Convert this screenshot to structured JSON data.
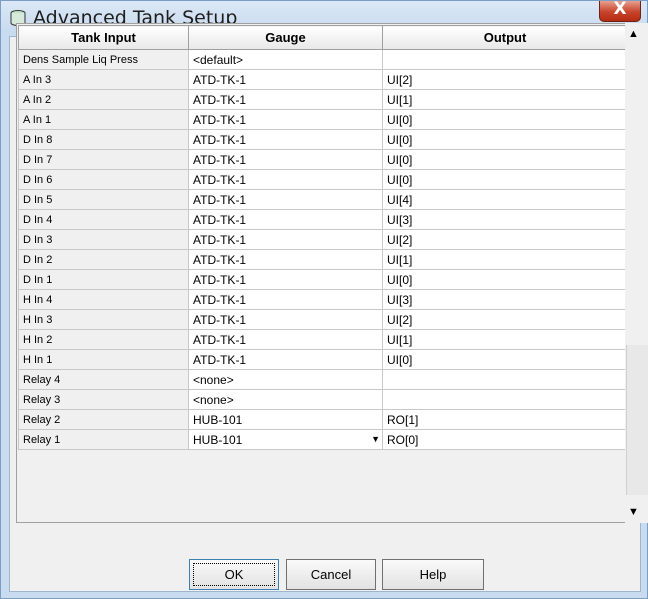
{
  "window": {
    "title": "Advanced Tank Setup",
    "close_label": "X"
  },
  "grid": {
    "headers": [
      "Tank Input",
      "Gauge",
      "Output"
    ],
    "rows": [
      {
        "input": "Dens Sample Liq Press",
        "gauge": "<default>",
        "output": ""
      },
      {
        "input": "A In 3",
        "gauge": "ATD-TK-1",
        "output": "UI[2]"
      },
      {
        "input": "A In 2",
        "gauge": "ATD-TK-1",
        "output": "UI[1]"
      },
      {
        "input": "A In 1",
        "gauge": "ATD-TK-1",
        "output": "UI[0]"
      },
      {
        "input": "D In 8",
        "gauge": "ATD-TK-1",
        "output": "UI[0]"
      },
      {
        "input": "D In 7",
        "gauge": "ATD-TK-1",
        "output": "UI[0]"
      },
      {
        "input": "D In 6",
        "gauge": "ATD-TK-1",
        "output": "UI[0]"
      },
      {
        "input": "D In 5",
        "gauge": "ATD-TK-1",
        "output": "UI[4]"
      },
      {
        "input": "D In 4",
        "gauge": "ATD-TK-1",
        "output": "UI[3]"
      },
      {
        "input": "D In 3",
        "gauge": "ATD-TK-1",
        "output": "UI[2]"
      },
      {
        "input": "D In 2",
        "gauge": "ATD-TK-1",
        "output": "UI[1]"
      },
      {
        "input": "D In 1",
        "gauge": "ATD-TK-1",
        "output": "UI[0]"
      },
      {
        "input": "H In 4",
        "gauge": "ATD-TK-1",
        "output": "UI[3]"
      },
      {
        "input": "H In 3",
        "gauge": "ATD-TK-1",
        "output": "UI[2]"
      },
      {
        "input": "H In 2",
        "gauge": "ATD-TK-1",
        "output": "UI[1]"
      },
      {
        "input": "H In 1",
        "gauge": "ATD-TK-1",
        "output": "UI[0]"
      },
      {
        "input": "Relay 4",
        "gauge": "<none>",
        "output": ""
      },
      {
        "input": "Relay 3",
        "gauge": "<none>",
        "output": ""
      },
      {
        "input": "Relay 2",
        "gauge": "HUB-101",
        "output": "RO[1]"
      },
      {
        "input": "Relay 1",
        "gauge": "HUB-101",
        "output": "RO[0]"
      }
    ]
  },
  "buttons": {
    "ok": "OK",
    "cancel": "Cancel",
    "help": "Help"
  },
  "colors": {
    "close": "#c7432b",
    "title_bar": "#c9dbef",
    "dialog_bg": "#f0f0f0"
  }
}
